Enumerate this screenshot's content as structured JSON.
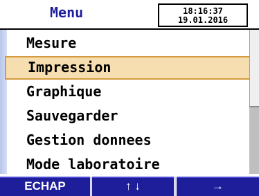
{
  "header": {
    "title": "Menu",
    "time": "18:16:37",
    "date": "19.01.2016"
  },
  "menu": {
    "items": [
      {
        "label": "Mesure"
      },
      {
        "label": "Impression"
      },
      {
        "label": "Graphique"
      },
      {
        "label": "Sauvegarder"
      },
      {
        "label": "Gestion donnees"
      },
      {
        "label": "Mode laboratoire"
      }
    ],
    "selected_index": 1
  },
  "softkeys": {
    "escape": "ECHAP",
    "updown": "↑ ↓",
    "enter": "→"
  },
  "colors": {
    "title": "#1e1ea0",
    "softkey_bg": "#1e1e9a",
    "selected_bg": "#f7deb0",
    "selected_border": "#d49a3e"
  }
}
